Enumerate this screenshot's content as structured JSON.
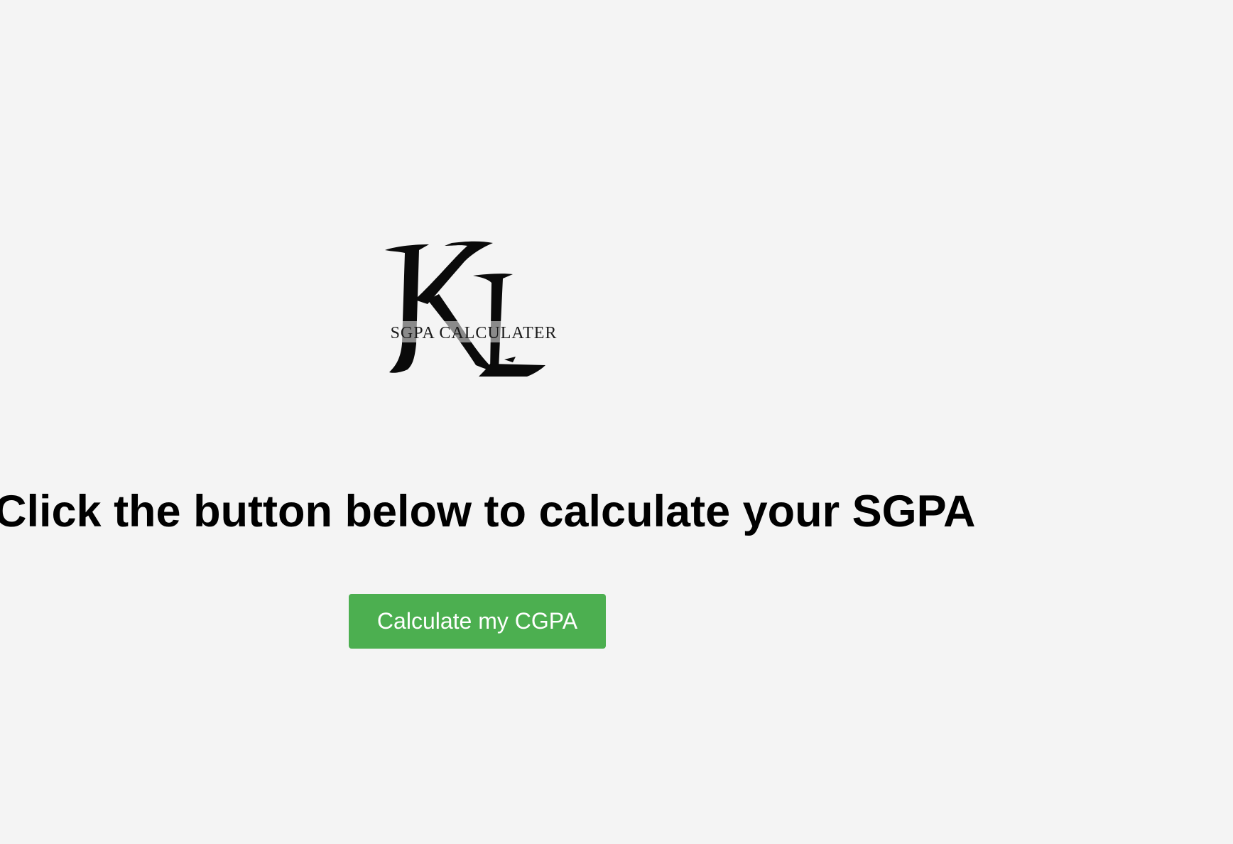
{
  "logo": {
    "monogram": "KL",
    "caption": "SGPA CALCULATER"
  },
  "headline": "Click the button below to calculate your SGPA",
  "cta": {
    "label": "Calculate my CGPA",
    "color": "#4caf50",
    "text_color": "#ffffff"
  },
  "colors": {
    "background": "#f4f4f4",
    "text": "#000000"
  }
}
